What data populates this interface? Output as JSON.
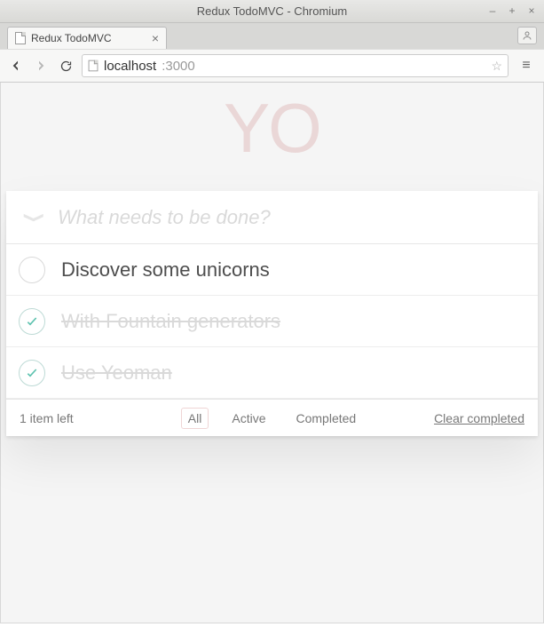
{
  "window": {
    "title": "Redux TodoMVC - Chromium"
  },
  "tab": {
    "label": "Redux TodoMVC"
  },
  "address": {
    "host": "localhost",
    "port": ":3000"
  },
  "hero": "YO",
  "new_todo": {
    "placeholder": "What needs to be done?"
  },
  "todos": [
    {
      "title": "Discover some unicorns",
      "completed": false
    },
    {
      "title": "With Fountain generators",
      "completed": true
    },
    {
      "title": "Use Yeoman",
      "completed": true
    }
  ],
  "footer": {
    "count_text": "1 item left",
    "filters": {
      "all": "All",
      "active": "Active",
      "completed": "Completed",
      "selected": "all"
    },
    "clear": "Clear completed"
  }
}
